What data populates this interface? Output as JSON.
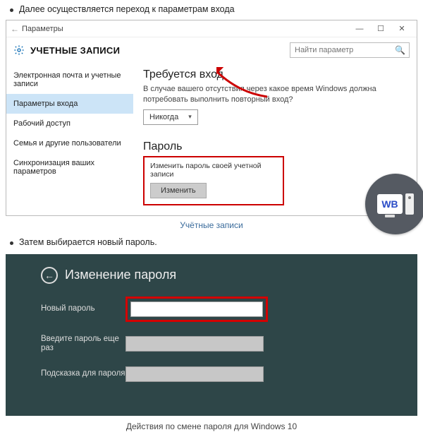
{
  "bullets": {
    "b1": "Далее осуществляется переход к параметрам входа",
    "b2": "Затем выбирается новый пароль."
  },
  "shot1": {
    "window_title": "Параметры",
    "header_title": "УЧЕТНЫЕ ЗАПИСИ",
    "search_placeholder": "Найти параметр",
    "sidebar": {
      "items": [
        {
          "label": "Электронная почта и учетные записи"
        },
        {
          "label": "Параметры входа"
        },
        {
          "label": "Рабочий доступ"
        },
        {
          "label": "Семья и другие пользователи"
        },
        {
          "label": "Синхронизация ваших параметров"
        }
      ]
    },
    "main": {
      "signin_title": "Требуется вход",
      "signin_desc": "В случае вашего отсутствия через какое время Windows должна потребовать выполнить повторный вход?",
      "signin_select": "Никогда",
      "password_title": "Пароль",
      "password_sub": "Изменить пароль своей учетной записи",
      "change_btn": "Изменить"
    },
    "caption": "Учётные записи"
  },
  "badge": {
    "text": "WB"
  },
  "shot2": {
    "title": "Изменение пароля",
    "rows": {
      "new_pwd": "Новый пароль",
      "confirm": "Введите пароль еще раз",
      "hint": "Подсказка для пароля"
    }
  },
  "caption2": "Действия по смене пароля для Windows 10"
}
